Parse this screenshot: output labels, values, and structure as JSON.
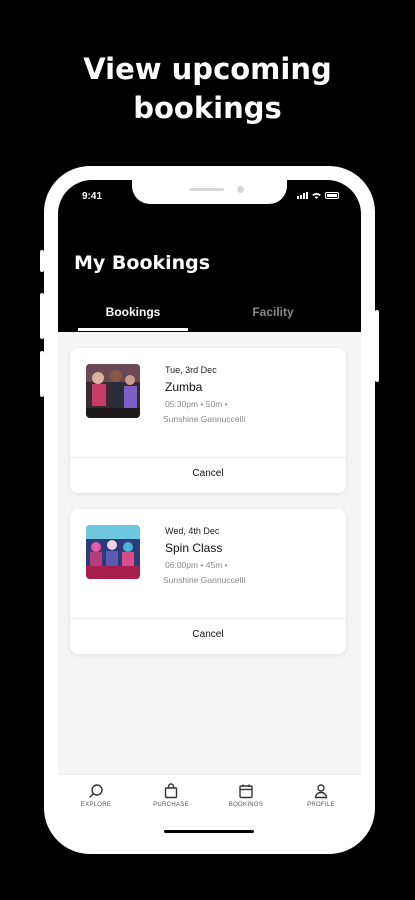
{
  "promo": {
    "line1": "View upcoming",
    "line2": "bookings"
  },
  "status_bar": {
    "time": "9:41"
  },
  "header": {
    "title": "My Bookings"
  },
  "tabs": [
    {
      "label": "Bookings",
      "active": true
    },
    {
      "label": "Facility",
      "active": false
    }
  ],
  "bookings": [
    {
      "date": "Tue, 3rd Dec",
      "title": "Zumba",
      "meta": "05:30pm • 50m •",
      "instructor": "Sunshine Gannuccelli",
      "cancel_label": "Cancel",
      "thumb_icon": "zumba-class-photo"
    },
    {
      "date": "Wed, 4th Dec",
      "title": "Spin Class",
      "meta": "06:00pm • 45m •",
      "instructor": "Sunshine Gannuccelli",
      "cancel_label": "Cancel",
      "thumb_icon": "spin-class-photo"
    }
  ],
  "tabbar": [
    {
      "label": "EXPLORE",
      "icon": "search-icon"
    },
    {
      "label": "PURCHASE",
      "icon": "shopping-bag-icon"
    },
    {
      "label": "BOOKINGS",
      "icon": "calendar-icon"
    },
    {
      "label": "PROFILE",
      "icon": "user-icon"
    }
  ],
  "colors": {
    "background": "#000000",
    "screen": "#f5f5f5",
    "card": "#ffffff",
    "muted_tab": "#8a8a8a"
  }
}
